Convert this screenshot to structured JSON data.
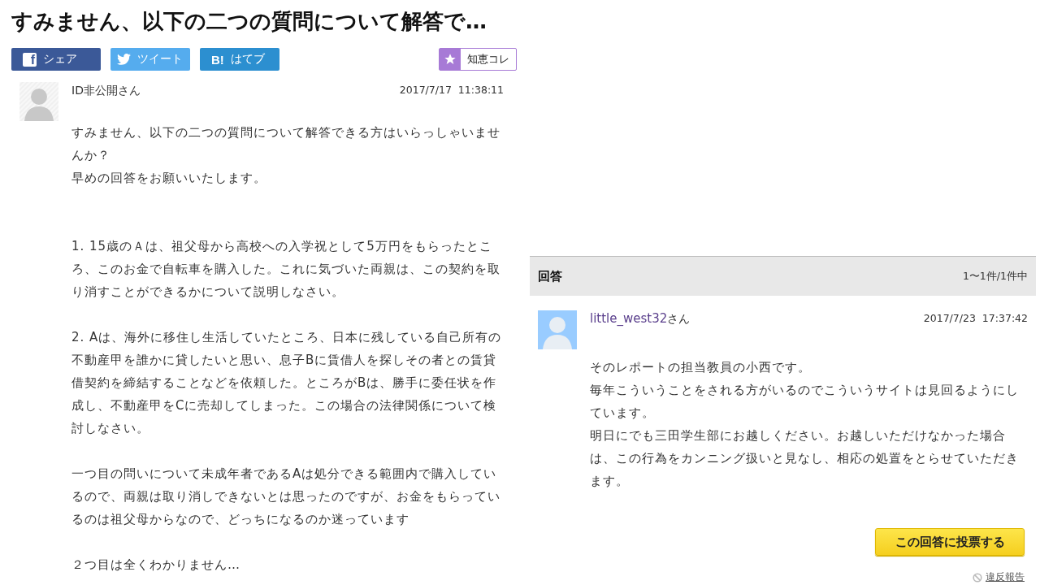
{
  "title": "すみません、以下の二つの質問について解答で…",
  "share_buttons": [
    {
      "kind": "facebook",
      "icon": "f",
      "label": "シェア"
    },
    {
      "kind": "twitter",
      "label": "ツイート"
    },
    {
      "kind": "hatena",
      "icon": "B!",
      "label": "はてブ"
    }
  ],
  "collect_button": {
    "label": "知恵コレ"
  },
  "question": {
    "user": "ID非公開さん",
    "date": "2017/7/17  11:38:11",
    "paragraphs": [
      "すみません、以下の二つの質問について解答できる方はいらっしゃいませんか？",
      "早めの回答をお願いいたします。",
      "1. 15歳のＡは、祖父母から高校への入学祝として5万円をもらったところ、このお金で自転車を購入した。これに気づいた両親は、この契約を取り消すことができるかについて説明しなさい。",
      "2. Aは、海外に移住し生活していたところ、日本に残している自己所有の不動産甲を誰かに貸したいと思い、息子Bに賃借人を探しその者との賃貸借契約を締結することなどを依頼した。ところがBは、勝手に委任状を作成し、不動産甲をCに売却してしまった。この場合の法律関係について検討しなさい。",
      "一つ目の問いについて未成年者であるAは処分できる範囲内で購入しているので、両親は取り消しできないとは思ったのですが、お金をもらっているのは祖父母からなので、どっちになるのか迷っています",
      "２つ目は全くわかりません…"
    ]
  },
  "answers_header": {
    "title": "回答",
    "count": "1〜1件/1件中"
  },
  "answer": {
    "user_link": "little_west32",
    "user_suffix": "さん",
    "date": "2017/7/23  17:37:42",
    "paragraphs": [
      "そのレポートの担当教員の小西です。",
      "毎年こういうことをされる方がいるのでこういうサイトは見回るようにしています。",
      "明日にでも三田学生部にお越しください。お越しいただけなかった場合は、この行為をカンニング扱いと見なし、相応の処置をとらせていただきます。"
    ],
    "vote_button": "この回答に投票する",
    "report_link": "違反報告"
  }
}
